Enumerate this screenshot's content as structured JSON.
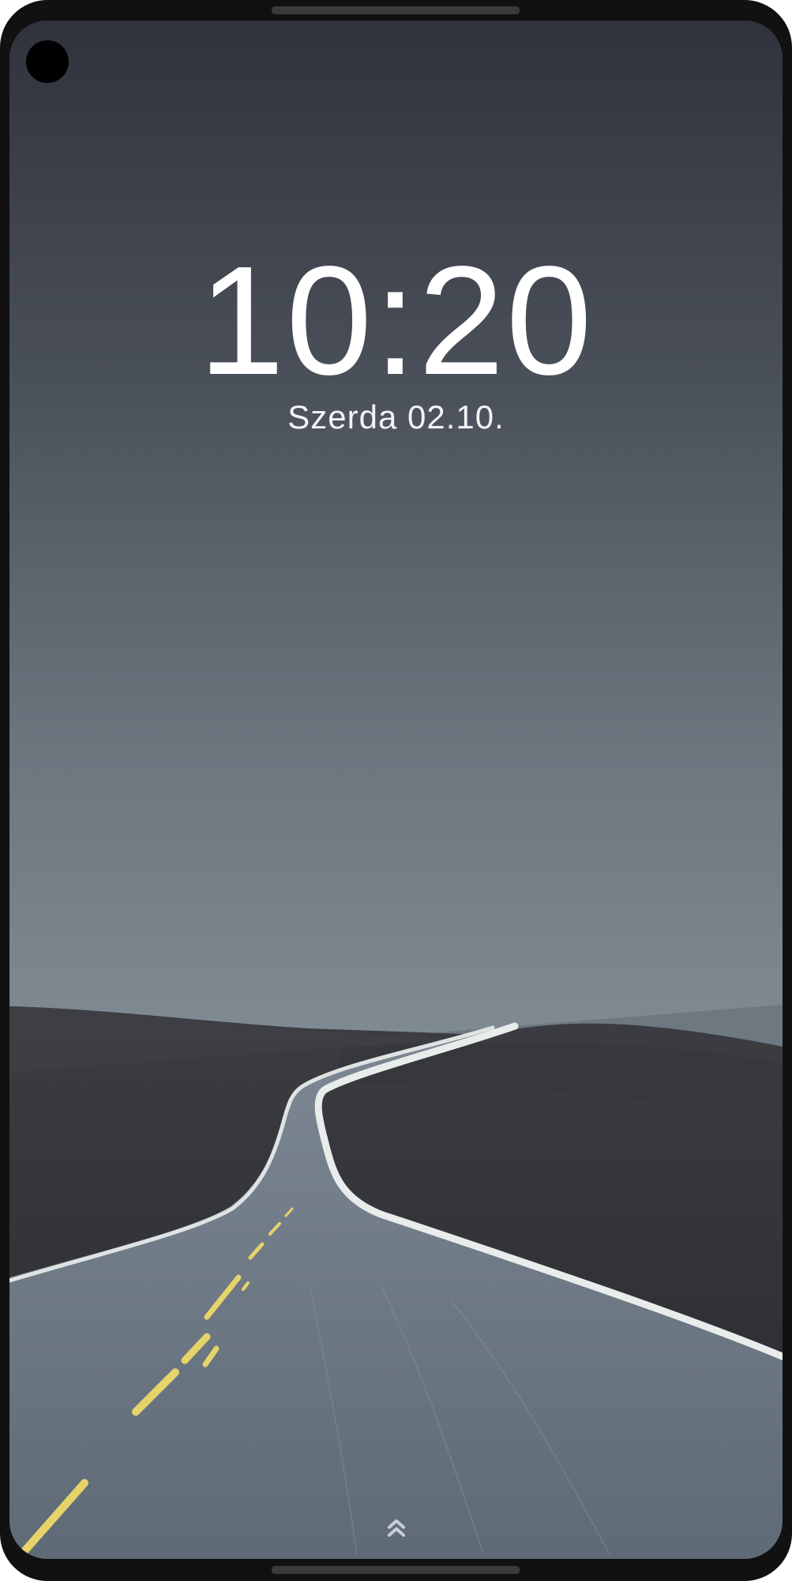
{
  "lockscreen": {
    "time": "10:20",
    "date": "Szerda 02.10."
  },
  "icons": {
    "camera": "front-camera-hole",
    "swipe_up": "double-chevron-up-icon"
  },
  "colors": {
    "frame": "#111111",
    "sky_top": "#30333c",
    "sky_bottom": "#7b8790",
    "ground": "#2f3035",
    "road": "#6b7683",
    "lane_marking": "#e6d36a",
    "edge_line": "#e8ecea",
    "text": "#ffffff"
  }
}
